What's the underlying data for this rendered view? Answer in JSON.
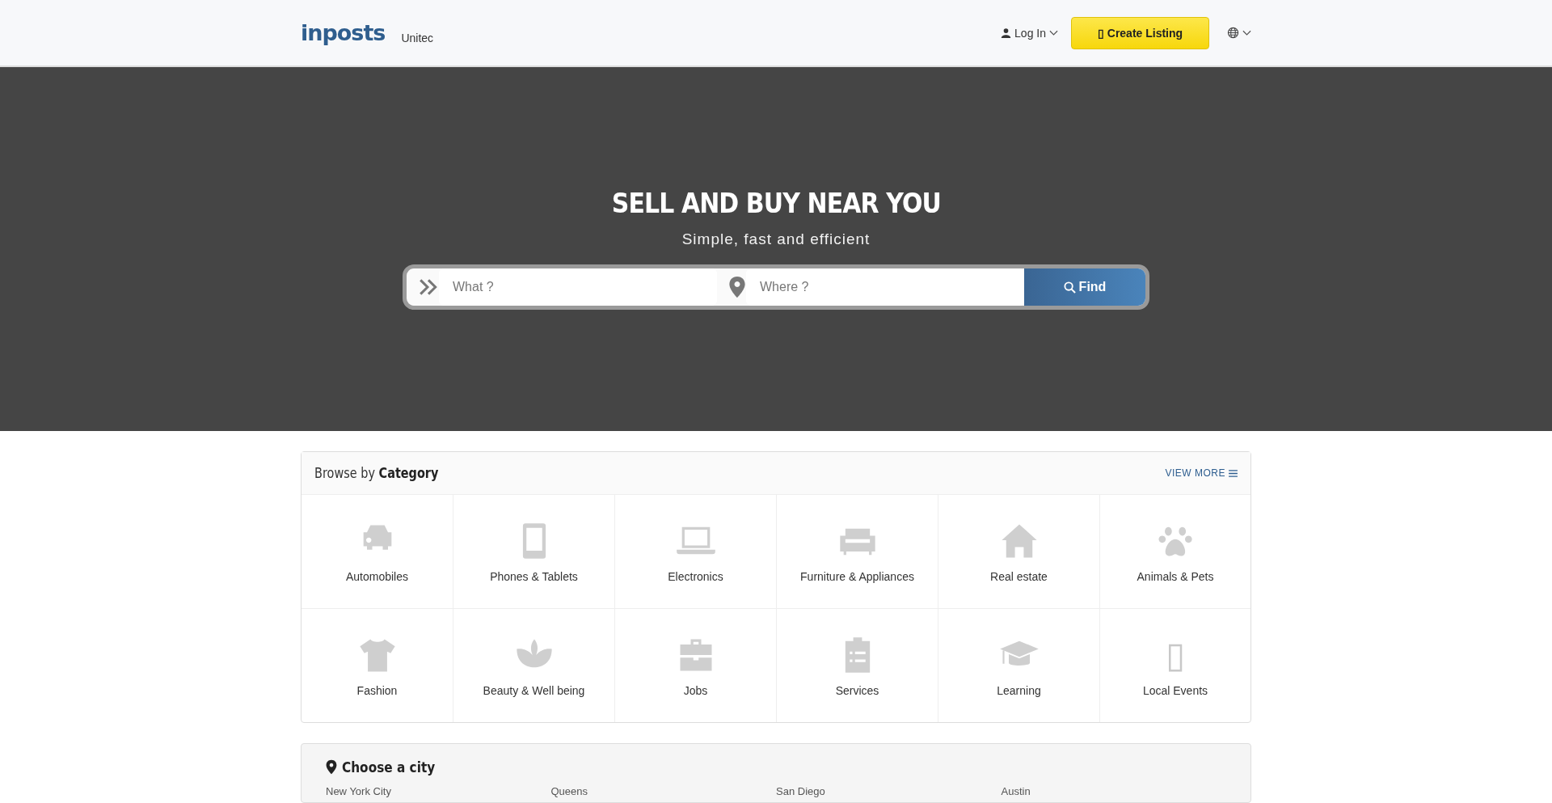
{
  "header": {
    "logo": "inposts",
    "flag_alt": "Unitec",
    "login": "Log In",
    "create_listing": {
      "icon": "▯",
      "label": "Create Listing"
    }
  },
  "hero": {
    "title": "SELL AND BUY NEAR YOU",
    "subtitle": "Simple, fast and efficient",
    "search": {
      "what_placeholder": "What ?",
      "where_placeholder": "Where ?",
      "button": "Find"
    }
  },
  "categories": {
    "title_plain": "Browse by",
    "title_bold": "Category",
    "view_more": "VIEW MORE",
    "items": [
      {
        "label": "Automobiles"
      },
      {
        "label": "Phones & Tablets"
      },
      {
        "label": "Electronics"
      },
      {
        "label": "Furniture & Appliances"
      },
      {
        "label": "Real estate"
      },
      {
        "label": "Animals & Pets"
      },
      {
        "label": "Fashion"
      },
      {
        "label": "Beauty & Well being"
      },
      {
        "label": "Jobs"
      },
      {
        "label": "Services"
      },
      {
        "label": "Learning"
      },
      {
        "label": "Local Events",
        "glyph": "▯"
      }
    ]
  },
  "cities": {
    "title": "Choose a city",
    "items": [
      "New York City",
      "Queens",
      "San Diego",
      "Austin"
    ]
  }
}
